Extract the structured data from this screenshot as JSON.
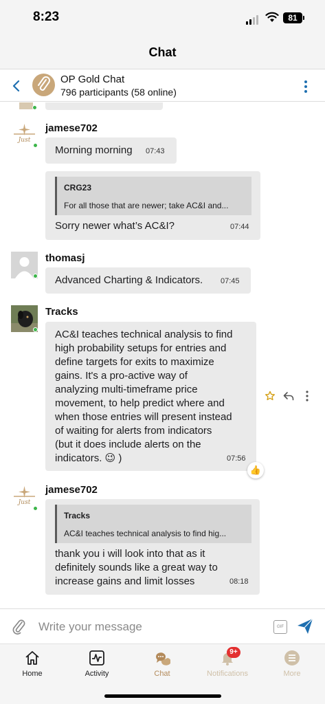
{
  "status": {
    "time": "8:23",
    "battery": "81"
  },
  "title": "Chat",
  "chat": {
    "name": "OP Gold Chat",
    "participants": "796 participants (58 online)"
  },
  "messages": [
    {
      "user": "jamese702",
      "text": "Morning morning",
      "time": "07:43"
    },
    {
      "quote_author": "CRG23",
      "quote_text": "For all those that are newer; take AC&I and...",
      "text": "Sorry newer what’s AC&I?",
      "time": "07:44"
    },
    {
      "user": "thomasj",
      "text": "Advanced Charting & Indicators.",
      "time": "07:45"
    },
    {
      "user": "Tracks",
      "lines": [
        "AC&I teaches technical analysis to find",
        "high probability setups for entries and",
        "define targets for exits to maximize",
        "gains. It's a pro-active way of",
        "analyzing multi-timeframe price",
        "movement, to help predict where and",
        "when those entries will present instead",
        "of waiting for alerts from indicators",
        "(but it does include alerts on the",
        "indicators. 😉 )"
      ],
      "time": "07:56"
    },
    {
      "user": "jamese702",
      "quote_author": "Tracks",
      "quote_text": "AC&I teaches technical analysis to find hig...",
      "lines": [
        "thank you i will look into that as it",
        "definitely sounds like a great way to",
        "increase gains and limit losses"
      ],
      "time": "08:18"
    }
  ],
  "reaction_emoji": "👍",
  "avatar_text": "Just",
  "input": {
    "placeholder": "Write your message",
    "gif": "GIF"
  },
  "tabs": [
    {
      "label": "Home",
      "color": "#1c1c1e"
    },
    {
      "label": "Activity",
      "color": "#1c1c1e"
    },
    {
      "label": "Chat",
      "color": "#b38a5a"
    },
    {
      "label": "Notifications",
      "color": "#cfc0a8",
      "badge": "9+"
    },
    {
      "label": "More",
      "color": "#cfc0a8"
    }
  ],
  "colors": {
    "accent": "#1e6fb0",
    "gold": "#c9a77a",
    "online": "#3cb54a",
    "bubble": "#eaeaea"
  }
}
